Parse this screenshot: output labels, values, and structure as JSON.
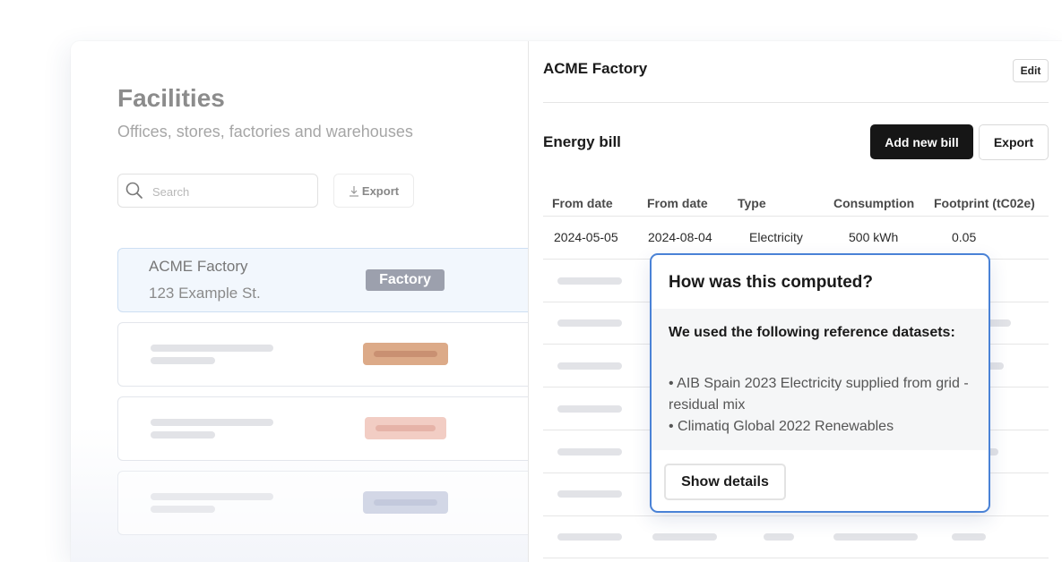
{
  "facilities": {
    "title": "Facilities",
    "subtitle": "Offices, stores, factories and warehouses",
    "search_placeholder": "Search",
    "export_label": "Export",
    "rows": [
      {
        "name": "ACME Factory",
        "address": "123 Example St.",
        "badge": "Factory"
      }
    ],
    "badge_colors": [
      "#9ca0ad",
      "#dcaa88",
      "#f2cdc4",
      "#d4d8e6"
    ]
  },
  "detail": {
    "title": "ACME Factory",
    "edit_label": "Edit",
    "section_title": "Energy bill",
    "add_bill_label": "Add new bill",
    "export_label": "Export",
    "columns": [
      "From date",
      "From date",
      "Type",
      "Consumption",
      "Footprint (tC02e)"
    ],
    "rows": [
      [
        "2024-05-05",
        "2024-08-04",
        "Electricity",
        "500 kWh",
        "0.05"
      ]
    ]
  },
  "popover": {
    "title": "How was this computed?",
    "intro": "We used the following reference datasets:",
    "datasets": [
      "• AIB Spain 2023 Electricity supplied from grid - residual mix",
      "• Climatiq Global 2022 Renewables"
    ],
    "show_details_label": "Show details",
    "border_color": "#4a82d6"
  }
}
